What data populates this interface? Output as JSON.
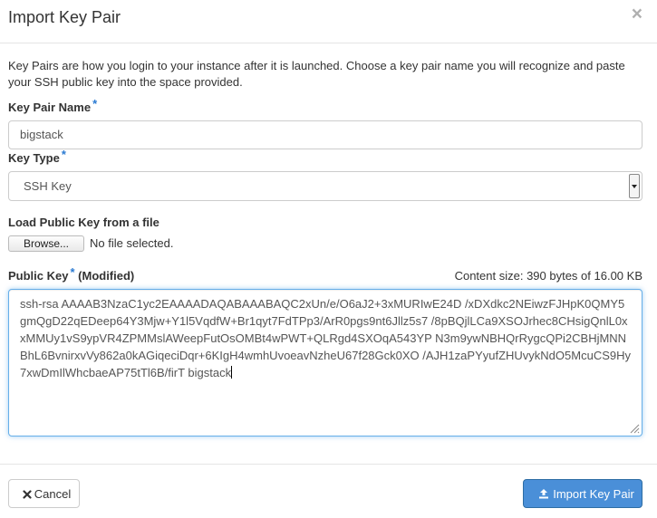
{
  "dialog": {
    "title": "Import Key Pair",
    "close_glyph": "×",
    "help_text": "Key Pairs are how you login to your instance after it is launched. Choose a key pair name you will recognize and paste your SSH public key into the space provided."
  },
  "form": {
    "key_pair_name": {
      "label": "Key Pair Name",
      "required_marker": "*",
      "value": "bigstack"
    },
    "key_type": {
      "label": "Key Type",
      "required_marker": "*",
      "value": "SSH Key"
    },
    "file": {
      "label": "Load Public Key from a file",
      "browse_label": "Browse...",
      "status": "No file selected."
    },
    "public_key": {
      "label": "Public Key",
      "required_marker": "*",
      "modified_note": "(Modified)",
      "content_size": "Content size: 390 bytes of 16.00 KB",
      "value": "ssh-rsa AAAAB3NzaC1yc2EAAAADAQABAAABAQC2xUn/e/O6aJ2+3xMURIwE24D /xDXdkc2NEiwzFJHpK0QMY5gmQgD22qEDeep64Y3Mjw+Y1l5VqdfW+Br1qyt7FdTPp3/ArR0pgs9nt6Jllz5s7 /8pBQjlLCa9XSOJrhec8CHsigQnlL0xxMMUy1vS9ypVR4ZPMMslAWeepFutOsOMBt4wPWT+QLRgd4SXOqA543YP N3m9ywNBHQrRygcQPi2CBHjMNNBhL6BvnirxvVy862a0kAGiqeciDqr+6KIgH4wmhUvoeavNzheU67f28Gck0XO /AJH1zaPYyufZHUvykNdO5McuCS9Hy7xwDmIlWhcbaeAP75tTl6B/firT bigstack"
    }
  },
  "footer": {
    "cancel_label": "Cancel",
    "cancel_icon": "close-icon",
    "submit_label": "Import Key Pair",
    "submit_icon": "upload-icon"
  },
  "colors": {
    "primary": "#4a8fd8",
    "required_marker": "#2a7ad2",
    "focus_border": "#66afe9"
  }
}
